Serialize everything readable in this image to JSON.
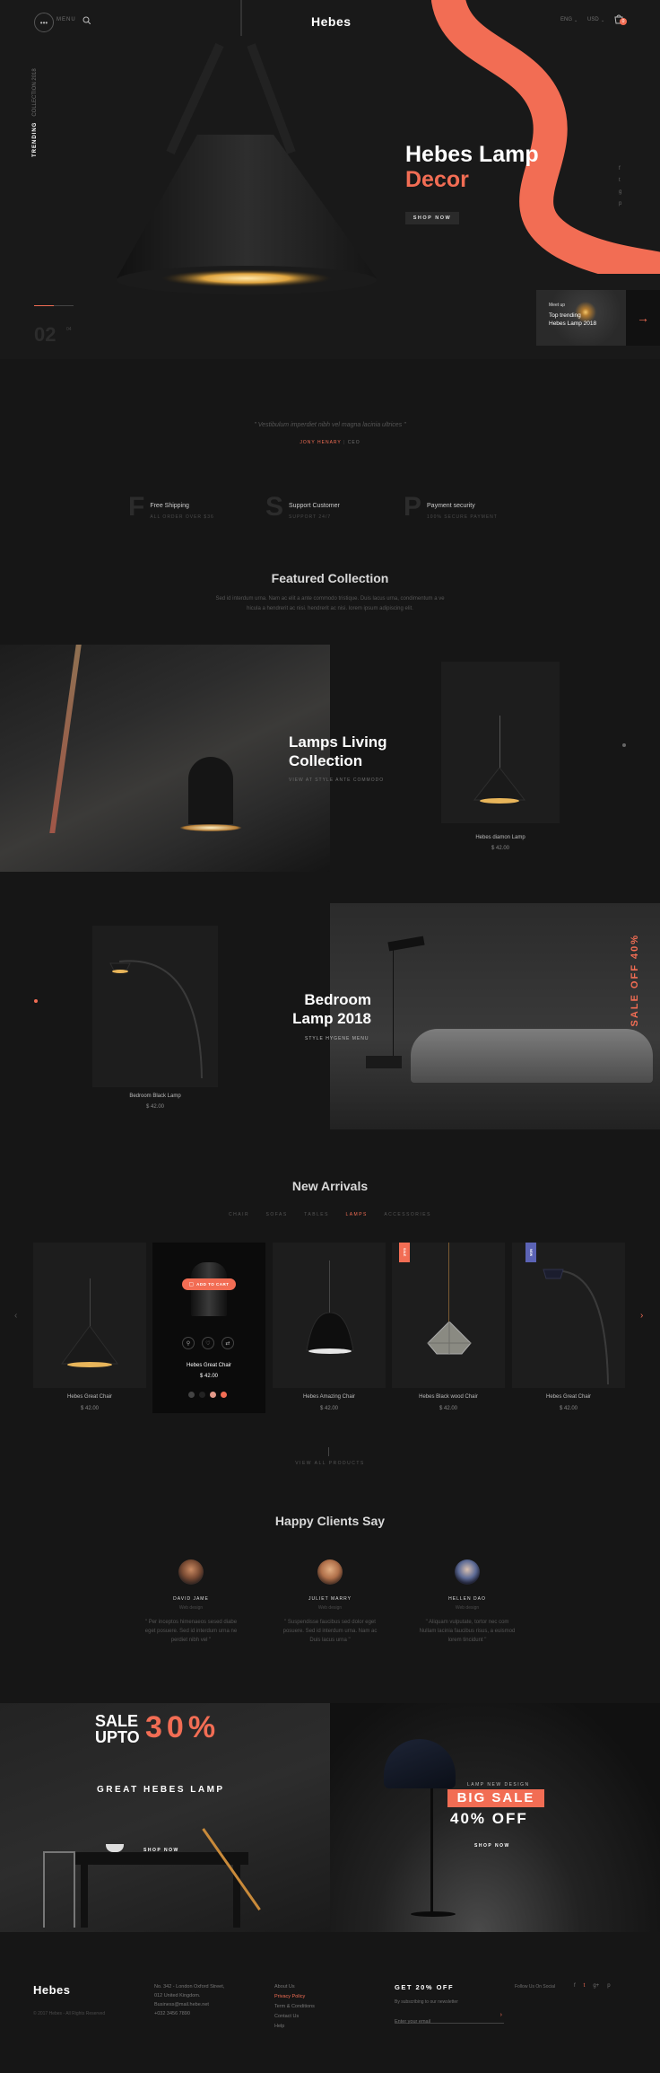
{
  "header": {
    "menu_label": "MENU",
    "brand": "Hebes",
    "lang": "ENG",
    "currency": "USD",
    "cart_count": "0"
  },
  "hero": {
    "side_text_a": "TRENDING",
    "side_text_b": "COLLECTION 2018",
    "title_line1": "Hebes Lamp",
    "title_line2": "Decor",
    "cta": "SHOP NOW",
    "slide_current": "02",
    "slide_total": "04",
    "social": [
      "f",
      "t",
      "g",
      "p"
    ],
    "meetup_tag": "Meet up",
    "meetup_title_line1": "Top trending",
    "meetup_title_line2": "Hebes Lamp 2018"
  },
  "quote": {
    "text": "\" Vestibulum imperdiet nibh vel magna lacinia ultrices \"",
    "author": "JONY HENARY",
    "role": "CEO"
  },
  "features": [
    {
      "letter": "F",
      "title": "Free Shipping",
      "sub": "ALL ORDER OVER $36"
    },
    {
      "letter": "S",
      "title": "Support Customer",
      "sub": "SUPPORT 24/7"
    },
    {
      "letter": "P",
      "title": "Payment security",
      "sub": "100% SECURE PAYMENT"
    }
  ],
  "featured": {
    "title": "Featured Collection",
    "desc_line1": "Sed id interdum urna. Nam ac elit a ante commodo tristique. Duis lacus urna, condimentum a ve",
    "desc_line2": "hicula a hendrerit ac nisi. hendrerit ac nisi. lorem ipsum adipiscing elit."
  },
  "living": {
    "title_line1": "Lamps Living",
    "title_line2": "Collection",
    "sub": "VIEW AT STYLE ANTE COMMODO",
    "product_name": "Hebes diamon Lamp",
    "product_price": "$ 42.00"
  },
  "bedroom": {
    "title_line1": "Bedroom",
    "title_line2": "Lamp 2018",
    "sub": "STYLE HYGENE MENU",
    "sale_vertical": "SALE OFF 40%",
    "product_name": "Bedroom Black Lamp",
    "product_price": "$ 42.00"
  },
  "arrivals": {
    "title": "New Arrivals",
    "tabs": [
      "CHAIR",
      "SOFAS",
      "TABLES",
      "LAMPS",
      "ACCESSORIES"
    ],
    "active_tab": "LAMPS",
    "add_to_cart": "ADD TO CART",
    "products": [
      {
        "name": "Hebes Great Chair",
        "price": "$ 42.00",
        "badge": ""
      },
      {
        "name": "Hebes Great Chair",
        "price": "$ 42.00",
        "badge": ""
      },
      {
        "name": "Hebes Amazing Chair",
        "price": "$ 42.00",
        "badge": ""
      },
      {
        "name": "Hebes Black wood Chair",
        "price": "$ 42.00",
        "badge": "SALE"
      },
      {
        "name": "Hebes Great Chair",
        "price": "$ 42.00",
        "badge": "NEW"
      }
    ],
    "view_all": "VIEW ALL PRODUCTS"
  },
  "clients": {
    "title": "Happy Clients Say",
    "items": [
      {
        "name": "DAVID JAME",
        "role": "Web design",
        "text_line1": "\" Per inceptos himenaeos sesed diabe",
        "text_line2": "eget posuere. Sed id interdum urna ne",
        "text_line3": "perdiet nibh vel \""
      },
      {
        "name": "JULIET MARRY",
        "role": "Web design",
        "text_line1": "\" Suspendisse faucibus sed dolor eget",
        "text_line2": "posuere. Sed id interdum urna. Nam ac",
        "text_line3": "Duis lacus urna \""
      },
      {
        "name": "HELLEN DAO",
        "role": "Web design",
        "text_line1": "\" Aliquam vulputate, tortor nec com",
        "text_line2": "Nullam lacinia faucibus risus, a euismod",
        "text_line3": "lorem tincidunt \""
      }
    ]
  },
  "promo_left": {
    "sale": "SALE",
    "upto": "UPTO",
    "percent": "30%",
    "sub": "GREAT HEBES LAMP",
    "cta": "SHOP NOW"
  },
  "promo_right": {
    "kicker": "LAMP NEW DESIGN",
    "big_sale": "BIG SALE",
    "off": "40% OFF",
    "cta": "SHOP NOW"
  },
  "footer": {
    "brand": "Hebes",
    "copyright": "© 2017 Hebes - All Rights Reserved",
    "address": [
      "No. 342 - London Oxford Street,",
      "012 United Kingdom.",
      "Business@mail.hebe.net",
      "+032 3456 7890"
    ],
    "links": [
      "About Us",
      "Privacy Policy",
      "Term & Conditions",
      "Contact Us",
      "Help"
    ],
    "newsletter_title": "GET 20% OFF",
    "newsletter_sub": "By subscribing to our newsletter",
    "email_placeholder": "Enter your email",
    "follow": "Follow Us On Social",
    "social": [
      "f",
      "t",
      "g+",
      "p"
    ]
  },
  "colors": {
    "accent": "#f26d54",
    "background": "#161616",
    "badge_blue": "#5b63b5"
  }
}
